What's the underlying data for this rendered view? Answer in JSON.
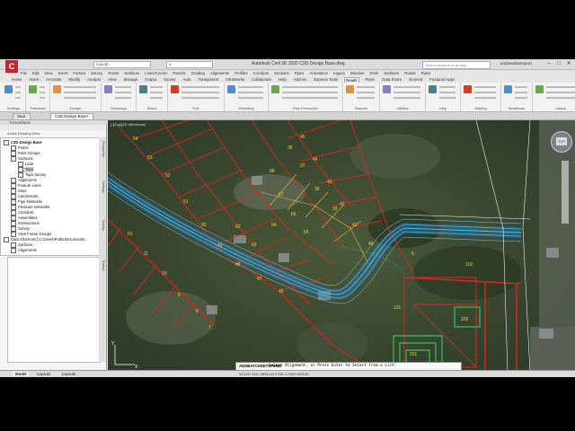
{
  "window": {
    "title": "Autodesk Civil 3D 2020   C3D Design Base.dwg",
    "search_placeholder": "Type a keyword or phrase",
    "user": "andrewdavenport",
    "logo": "C",
    "workspace": "Civil 3D",
    "layer": "0"
  },
  "ribbon": {
    "tabs": [
      "File",
      "Edit",
      "View",
      "Insert",
      "Format",
      "Survey",
      "Points",
      "Surfaces",
      "Lines/Curves",
      "Parcels",
      "Grading",
      "Alignments",
      "Profiles",
      "Corridors",
      "Sections",
      "Pipes",
      "Annotation",
      "Inquiry",
      "Window",
      "Xrefs",
      "Surfaces",
      "Roads",
      "Pipes"
    ],
    "tabs2": [
      "Home",
      "Insert",
      "Annotate",
      "Modify",
      "Analyze",
      "View",
      "Manage",
      "Output",
      "Survey",
      "Auto",
      "Transparent",
      "InfraWorks",
      "Collaborate",
      "Help",
      "Add-ins",
      "Express Tools",
      "Roads",
      "Pipes",
      "Data Share",
      "General",
      "Featured Apps"
    ],
    "active_tab2": "Roads",
    "groups": [
      "Settings",
      "Templates",
      "Design",
      "Driveways",
      "Select",
      "Edit",
      "Modelling",
      "Plan Production",
      "Reports",
      "Utilities",
      "Help",
      "Staking",
      "Workflows",
      "Labels"
    ]
  },
  "doctabs": [
    "Start",
    "C3D Design Base*"
  ],
  "toolspace": {
    "title": "TOOLSPACE",
    "nav_label": "Active Drawing View",
    "side_tabs": [
      "Prospector",
      "Settings",
      "Survey",
      "Toolbox"
    ],
    "tree": [
      {
        "label": "C3D Design Base",
        "level": 0,
        "bold": true
      },
      {
        "label": "Points",
        "level": 1
      },
      {
        "label": "Point Groups",
        "level": 1
      },
      {
        "label": "Surfaces",
        "level": 1
      },
      {
        "label": "Lidar",
        "level": 2
      },
      {
        "label": "Topo",
        "level": 2,
        "selected": true
      },
      {
        "label": "Topo Survey",
        "level": 2
      },
      {
        "label": "Alignments",
        "level": 1
      },
      {
        "label": "Feature Lines",
        "level": 1
      },
      {
        "label": "Sites",
        "level": 1
      },
      {
        "label": "Catchments",
        "level": 1
      },
      {
        "label": "Pipe Networks",
        "level": 1
      },
      {
        "label": "Pressure Networks",
        "level": 1
      },
      {
        "label": "Corridors",
        "level": 1
      },
      {
        "label": "Assemblies",
        "level": 1
      },
      {
        "label": "Intersections",
        "level": 1
      },
      {
        "label": "Survey",
        "level": 1
      },
      {
        "label": "View Frame Groups",
        "level": 1
      },
      {
        "label": "Data Shortcuts [ C:\\Users\\Public\\Documents...",
        "level": 0
      },
      {
        "label": "Surfaces",
        "level": 1
      },
      {
        "label": "Alignments",
        "level": 1
      }
    ]
  },
  "viewport": {
    "label": "[-][Top][2D Wireframe]",
    "viewcube": "TOP",
    "lots": [
      "54",
      "53",
      "52",
      "51",
      "50",
      "49",
      "48",
      "47",
      "46",
      "45",
      "44",
      "43",
      "42",
      "41",
      "40",
      "39",
      "38",
      "37",
      "36",
      "68",
      "67",
      "66",
      "65",
      "64",
      "63",
      "62",
      "61",
      "11",
      "10",
      "9",
      "8",
      "7",
      "6",
      "102",
      "101",
      "202",
      "201"
    ]
  },
  "command": {
    "prefix": "ADDBATCHSETSPEND",
    "text": "Select Alignment, or Press Enter to Select from a List:"
  },
  "status": {
    "tabs": [
      "Model",
      "Layout1",
      "Layout2"
    ],
    "coords": "341437.520, 6803143.4788, 0.0000  MODEL",
    "model": "MODEL"
  },
  "colors": {
    "parcel_red": "#e0261b",
    "alignment_blue": "#3fa9f5",
    "design_cyan": "#39d3ff",
    "lot_yellow": "#d8c23a",
    "green_proposed": "#3be36f"
  }
}
